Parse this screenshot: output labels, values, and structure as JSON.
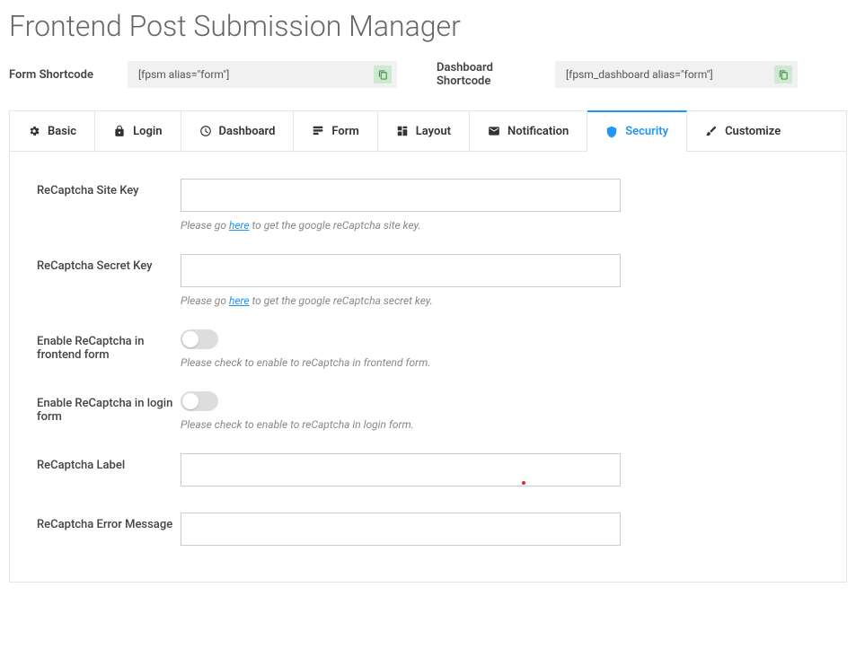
{
  "page_title": "Frontend Post Submission Manager",
  "shortcodes": {
    "form_label": "Form Shortcode",
    "form_value": "[fpsm alias=\"form\"]",
    "dashboard_label": "Dashboard Shortcode",
    "dashboard_value": "[fpsm_dashboard alias=\"form\"]"
  },
  "tabs": {
    "basic": "Basic",
    "login": "Login",
    "dashboard": "Dashboard",
    "form": "Form",
    "layout": "Layout",
    "notification": "Notification",
    "security": "Security",
    "customize": "Customize"
  },
  "fields": {
    "site_key": {
      "label": "ReCaptcha Site Key",
      "help_prefix": "Please go ",
      "help_link": "here",
      "help_suffix": " to get the google reCaptcha site key."
    },
    "secret_key": {
      "label": "ReCaptcha Secret Key",
      "help_prefix": "Please go ",
      "help_link": "here",
      "help_suffix": " to get the google reCaptcha secret key."
    },
    "enable_frontend": {
      "label": "Enable ReCaptcha in frontend form",
      "help": "Please check to enable to reCaptcha in frontend form."
    },
    "enable_login": {
      "label": "Enable ReCaptcha in login form",
      "help": "Please check to enable to reCaptcha in login form."
    },
    "recaptcha_label": {
      "label": "ReCaptcha Label"
    },
    "recaptcha_error": {
      "label": "ReCaptcha Error Message"
    }
  }
}
